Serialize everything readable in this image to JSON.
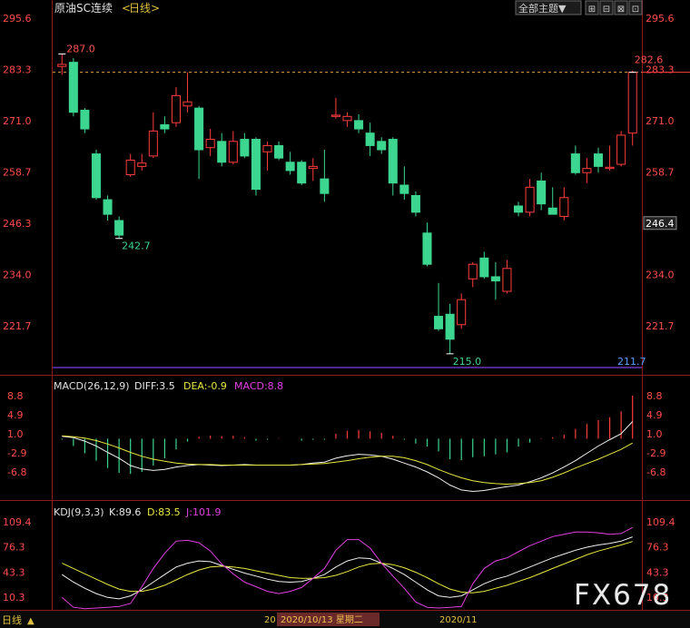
{
  "header": {
    "instrument": "原油SC连续",
    "period_open": "<",
    "period": "日线",
    "period_close": ">",
    "view_select": "全部主题▼",
    "buttons": [
      "⊞",
      "⊟",
      "⊠",
      "⊡"
    ]
  },
  "price_panel": {
    "yticks": [
      "295.6",
      "283.3",
      "271.0",
      "258.7",
      "246.3",
      "234.0",
      "221.7"
    ],
    "high_label": "287.0",
    "low_label_1": "242.7",
    "low_label_2": "215.0",
    "last_label": "282.6",
    "current_price_tag": "246.4",
    "bottom_line_label": "211.7",
    "colors": {
      "up": "#ff3c3c",
      "down": "#3cd690",
      "axis": "#ff4b4b",
      "support": "#7b3fe4"
    }
  },
  "macd_panel": {
    "title": "MACD(26,12,9)",
    "diff_label": "DIFF:3.5",
    "dea_label": "DEA:-0.9",
    "macd_label": "MACD:8.8",
    "yticks": [
      "8.8",
      "4.9",
      "1.0",
      "-2.9",
      "-6.8"
    ]
  },
  "kdj_panel": {
    "title": "KDJ(9,3,3)",
    "k_label": "K:89.6",
    "d_label": "D:83.5",
    "j_label": "J:101.9",
    "yticks": [
      "109.4",
      "76.3",
      "43.3",
      "10.3"
    ]
  },
  "footer": {
    "period": "日线",
    "arrow": "▲",
    "date_fragment": "20",
    "cursor_date": "2020/10/13 星期二",
    "month_label": "2020/11"
  },
  "watermark": "FX678",
  "chart_data": [
    {
      "type": "candlestick",
      "title": "原油SC连续",
      "ylim": [
        211.7,
        295.6
      ],
      "candles": [
        {
          "o": 284.0,
          "h": 287.0,
          "l": 282.0,
          "c": 284.5
        },
        {
          "o": 285.0,
          "h": 286.0,
          "l": 272.0,
          "c": 273.0
        },
        {
          "o": 273.5,
          "h": 274.0,
          "l": 268.0,
          "c": 269.0
        },
        {
          "o": 263.0,
          "h": 264.0,
          "l": 252.0,
          "c": 252.5
        },
        {
          "o": 252.0,
          "h": 253.0,
          "l": 247.0,
          "c": 248.5
        },
        {
          "o": 247.0,
          "h": 248.0,
          "l": 242.7,
          "c": 243.5
        },
        {
          "o": 258.0,
          "h": 263.0,
          "l": 257.5,
          "c": 261.5
        },
        {
          "o": 260.0,
          "h": 263.0,
          "l": 259.0,
          "c": 260.8
        },
        {
          "o": 262.5,
          "h": 273.0,
          "l": 262.0,
          "c": 268.5
        },
        {
          "o": 270.0,
          "h": 272.0,
          "l": 268.0,
          "c": 269.0
        },
        {
          "o": 270.5,
          "h": 279.0,
          "l": 269.5,
          "c": 277.0
        },
        {
          "o": 274.5,
          "h": 282.6,
          "l": 273.0,
          "c": 275.5
        },
        {
          "o": 274.0,
          "h": 274.5,
          "l": 257.0,
          "c": 264.0
        },
        {
          "o": 264.5,
          "h": 269.0,
          "l": 262.5,
          "c": 266.5
        },
        {
          "o": 266.0,
          "h": 268.0,
          "l": 260.0,
          "c": 261.0
        },
        {
          "o": 261.0,
          "h": 268.5,
          "l": 260.5,
          "c": 266.0
        },
        {
          "o": 266.5,
          "h": 268.0,
          "l": 262.0,
          "c": 262.5
        },
        {
          "o": 266.5,
          "h": 267.0,
          "l": 253.0,
          "c": 254.5
        },
        {
          "o": 263.5,
          "h": 266.0,
          "l": 259.0,
          "c": 265.0
        },
        {
          "o": 265.0,
          "h": 266.0,
          "l": 261.5,
          "c": 262.0
        },
        {
          "o": 261.0,
          "h": 263.5,
          "l": 258.0,
          "c": 259.0
        },
        {
          "o": 261.0,
          "h": 261.5,
          "l": 255.5,
          "c": 256.0
        },
        {
          "o": 259.5,
          "h": 262.0,
          "l": 256.5,
          "c": 260.0
        },
        {
          "o": 257.0,
          "h": 264.0,
          "l": 251.5,
          "c": 253.5
        },
        {
          "o": 272.0,
          "h": 276.5,
          "l": 271.5,
          "c": 272.3
        },
        {
          "o": 271.0,
          "h": 273.0,
          "l": 269.5,
          "c": 272.0
        },
        {
          "o": 271.0,
          "h": 272.5,
          "l": 268.0,
          "c": 269.0
        },
        {
          "o": 268.0,
          "h": 270.5,
          "l": 262.5,
          "c": 265.0
        },
        {
          "o": 266.0,
          "h": 267.0,
          "l": 263.0,
          "c": 264.0
        },
        {
          "o": 266.5,
          "h": 267.0,
          "l": 253.0,
          "c": 256.0
        },
        {
          "o": 255.5,
          "h": 260.0,
          "l": 252.0,
          "c": 253.5
        },
        {
          "o": 253.0,
          "h": 254.0,
          "l": 248.0,
          "c": 249.0
        },
        {
          "o": 244.0,
          "h": 246.5,
          "l": 236.0,
          "c": 236.5
        },
        {
          "o": 224.0,
          "h": 232.0,
          "l": 220.5,
          "c": 221.0
        },
        {
          "o": 224.5,
          "h": 227.0,
          "l": 215.0,
          "c": 218.5
        },
        {
          "o": 222.0,
          "h": 229.5,
          "l": 221.0,
          "c": 228.0
        },
        {
          "o": 233.0,
          "h": 237.0,
          "l": 231.0,
          "c": 236.5
        },
        {
          "o": 238.0,
          "h": 239.5,
          "l": 233.0,
          "c": 233.5
        },
        {
          "o": 233.5,
          "h": 237.0,
          "l": 228.0,
          "c": 232.5
        },
        {
          "o": 230.0,
          "h": 237.5,
          "l": 229.5,
          "c": 235.5
        },
        {
          "o": 250.5,
          "h": 251.5,
          "l": 248.0,
          "c": 249.0
        },
        {
          "o": 249.0,
          "h": 257.0,
          "l": 248.0,
          "c": 255.0
        },
        {
          "o": 256.5,
          "h": 258.5,
          "l": 249.5,
          "c": 251.0
        },
        {
          "o": 250.0,
          "h": 255.0,
          "l": 249.0,
          "c": 248.5
        },
        {
          "o": 248.0,
          "h": 255.0,
          "l": 247.0,
          "c": 252.5
        },
        {
          "o": 263.0,
          "h": 265.0,
          "l": 258.0,
          "c": 258.5
        },
        {
          "o": 258.5,
          "h": 262.0,
          "l": 256.0,
          "c": 259.5
        },
        {
          "o": 263.0,
          "h": 264.5,
          "l": 258.5,
          "c": 260.0
        },
        {
          "o": 259.5,
          "h": 265.0,
          "l": 259.0,
          "c": 259.8
        },
        {
          "o": 260.5,
          "h": 268.5,
          "l": 260.0,
          "c": 267.5
        },
        {
          "o": 268.0,
          "h": 283.0,
          "l": 265.0,
          "c": 282.6
        }
      ]
    },
    {
      "type": "bar+line",
      "title": "MACD(26,12,9)",
      "ylim": [
        -12.0,
        8.8
      ],
      "series": [
        {
          "name": "MACD",
          "values": [
            -0.2,
            -1.5,
            -3.0,
            -4.5,
            -6.0,
            -7.0,
            -7.2,
            -6.8,
            -5.5,
            -4.0,
            -2.2,
            -0.6,
            0.4,
            0.6,
            0.5,
            0.6,
            0.3,
            -0.4,
            -0.2,
            0.1,
            0.0,
            -0.4,
            -0.2,
            -0.2,
            1.0,
            1.6,
            1.8,
            1.5,
            1.2,
            0.6,
            -0.2,
            -1.0,
            -1.6,
            -2.6,
            -4.2,
            -4.4,
            -3.8,
            -3.6,
            -3.2,
            -2.8,
            -1.6,
            -0.8,
            0.1,
            0.3,
            0.8,
            2.0,
            3.0,
            3.8,
            4.4,
            5.6,
            8.8
          ]
        },
        {
          "name": "DIFF",
          "values": [
            0.5,
            0.2,
            -0.5,
            -1.5,
            -2.8,
            -4.0,
            -5.5,
            -6.2,
            -6.5,
            -6.3,
            -5.8,
            -5.5,
            -5.3,
            -5.4,
            -5.5,
            -5.4,
            -5.3,
            -5.4,
            -5.4,
            -5.4,
            -5.4,
            -5.3,
            -5.0,
            -4.8,
            -4.0,
            -3.5,
            -3.2,
            -3.3,
            -3.6,
            -4.2,
            -5.0,
            -5.8,
            -6.8,
            -8.0,
            -9.5,
            -10.5,
            -10.8,
            -10.6,
            -10.2,
            -9.8,
            -9.5,
            -8.8,
            -8.0,
            -7.0,
            -5.8,
            -4.5,
            -3.0,
            -1.5,
            -0.2,
            1.0,
            3.5
          ]
        },
        {
          "name": "DEA",
          "values": [
            0.6,
            0.4,
            0.1,
            -0.4,
            -1.1,
            -1.9,
            -2.8,
            -3.6,
            -4.2,
            -4.6,
            -5.0,
            -5.2,
            -5.3,
            -5.3,
            -5.4,
            -5.4,
            -5.4,
            -5.4,
            -5.4,
            -5.4,
            -5.4,
            -5.3,
            -5.2,
            -5.1,
            -4.8,
            -4.5,
            -4.1,
            -3.8,
            -3.6,
            -3.6,
            -3.9,
            -4.5,
            -5.3,
            -6.3,
            -7.2,
            -8.0,
            -8.6,
            -9.0,
            -9.2,
            -9.3,
            -9.2,
            -9.0,
            -8.6,
            -7.9,
            -7.0,
            -6.0,
            -5.1,
            -4.2,
            -3.2,
            -2.2,
            -0.9
          ]
        }
      ]
    },
    {
      "type": "line",
      "title": "KDJ(9,3,3)",
      "ylim": [
        -4.0,
        109.4
      ],
      "series": [
        {
          "name": "K",
          "values": [
            40,
            30,
            22,
            15,
            10,
            8,
            12,
            20,
            30,
            40,
            50,
            55,
            58,
            57,
            52,
            47,
            42,
            38,
            34,
            31,
            30,
            31,
            35,
            40,
            50,
            58,
            62,
            61,
            55,
            48,
            40,
            30,
            20,
            12,
            10,
            12,
            20,
            28,
            34,
            38,
            44,
            50,
            56,
            62,
            67,
            72,
            76,
            79,
            81,
            84,
            89.6
          ]
        },
        {
          "name": "D",
          "values": [
            55,
            48,
            41,
            34,
            27,
            21,
            18,
            18,
            21,
            26,
            33,
            40,
            46,
            50,
            51,
            50,
            48,
            45,
            42,
            39,
            36,
            35,
            35,
            36,
            39,
            44,
            50,
            54,
            55,
            53,
            49,
            43,
            36,
            28,
            21,
            17,
            16,
            18,
            22,
            26,
            31,
            36,
            42,
            48,
            54,
            60,
            66,
            71,
            75,
            79,
            83.5
          ]
        },
        {
          "name": "J",
          "values": [
            10,
            -3,
            -5,
            -4,
            -3,
            -2,
            2,
            24,
            48,
            68,
            84,
            85,
            82,
            71,
            54,
            41,
            30,
            24,
            18,
            15,
            18,
            23,
            35,
            48,
            72,
            86,
            86,
            75,
            55,
            38,
            22,
            4,
            -3,
            -4,
            -3,
            -2,
            28,
            48,
            58,
            62,
            70,
            78,
            84,
            90,
            93,
            96,
            96,
            95,
            93,
            94,
            101.9
          ]
        }
      ]
    }
  ]
}
